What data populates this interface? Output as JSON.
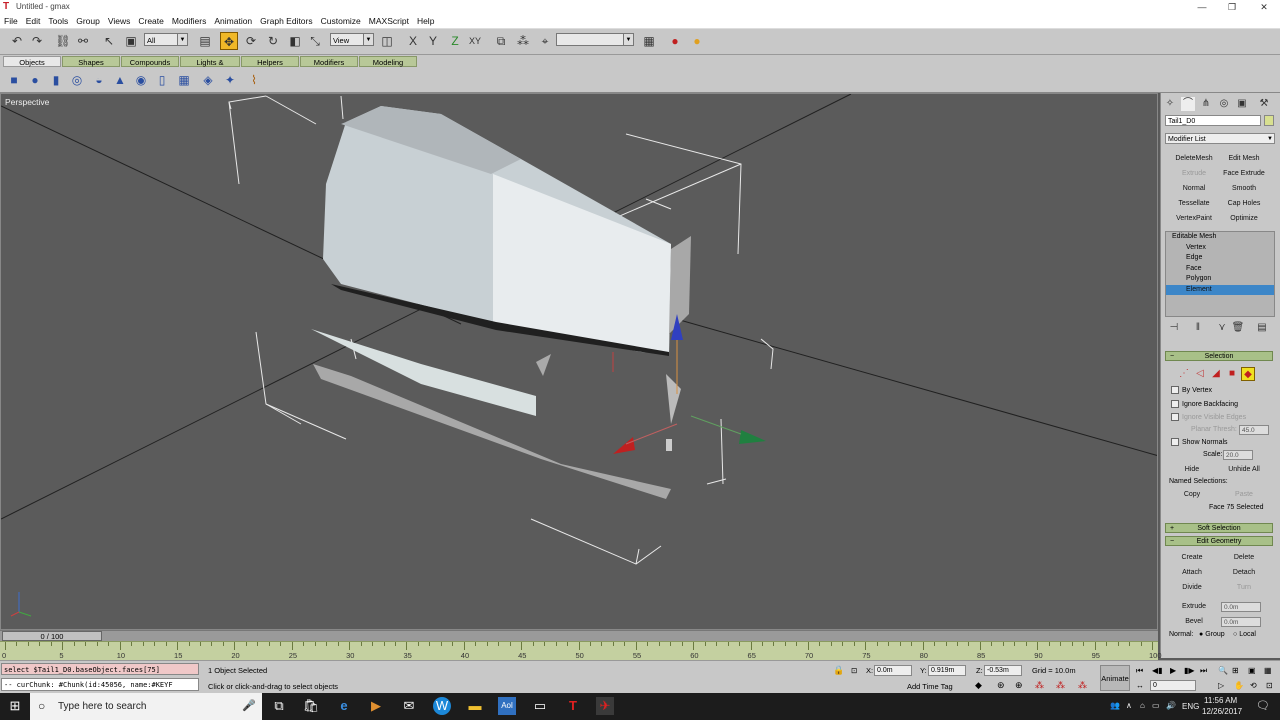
{
  "window": {
    "title": "Untitled - gmax",
    "minimize": "—",
    "maximize": "❐",
    "close": "✕"
  },
  "menu": [
    "File",
    "Edit",
    "Tools",
    "Group",
    "Views",
    "Create",
    "Modifiers",
    "Animation",
    "Graph Editors",
    "Customize",
    "MAXScript",
    "Help"
  ],
  "toolbar": {
    "selection_filter": "All",
    "ref_coord": "View",
    "named_selection": ""
  },
  "tabs": [
    "Objects",
    "Shapes",
    "Compounds",
    "Lights & Cameras",
    "Helpers",
    "Modifiers",
    "Modeling"
  ],
  "viewport": {
    "label": "Perspective"
  },
  "command_panel": {
    "object_name": "Tail1_D0",
    "modifier_list": "Modifier List",
    "modifier_buttons": [
      "DeleteMesh",
      "Edit Mesh",
      "Extrude",
      "Face Extrude",
      "Normal",
      "Smooth",
      "Tessellate",
      "Cap Holes",
      "VertexPaint",
      "Optimize"
    ],
    "stack": {
      "root": "Editable Mesh",
      "items": [
        "Vertex",
        "Edge",
        "Face",
        "Polygon",
        "Element"
      ],
      "selected": "Element"
    },
    "selection": {
      "title": "Selection",
      "by_vertex": "By Vertex",
      "ignore_backfacing": "Ignore Backfacing",
      "ignore_visible_edges": "Ignore Visible Edges",
      "planar_thresh_label": "Planar Thresh:",
      "planar_thresh_value": "45.0",
      "show_normals": "Show Normals",
      "scale_label": "Scale:",
      "scale_value": "20.0",
      "hide": "Hide",
      "unhide_all": "Unhide All",
      "named_selections": "Named Selections:",
      "copy": "Copy",
      "paste": "Paste",
      "status": "Face 75 Selected"
    },
    "soft_selection": "Soft Selection",
    "edit_geometry": {
      "title": "Edit Geometry",
      "create": "Create",
      "delete": "Delete",
      "attach": "Attach",
      "detach": "Detach",
      "divide": "Divide",
      "turn": "Turn",
      "extrude": "Extrude",
      "extrude_value": "0.0m",
      "bevel": "Bevel",
      "bevel_value": "0.0m",
      "normal": "Normal:",
      "group": "Group",
      "local": "Local"
    }
  },
  "timeline": {
    "frame": "0 / 100",
    "ticks": [
      "0",
      "5",
      "10",
      "15",
      "20",
      "25",
      "30",
      "35",
      "40",
      "45",
      "50",
      "55",
      "60",
      "65",
      "70",
      "75",
      "80",
      "85",
      "90",
      "95",
      "100"
    ]
  },
  "status": {
    "maxscript_line1": "select $Tail1_D0.baseObject.faces[75]",
    "maxscript_line2": "-- curChunk: #Chunk(id:45056, name:#KEYF",
    "selected": "1 Object Selected",
    "prompt": "Click or click-and-drag to select objects",
    "x_label": "X:",
    "x_value": "0.0m",
    "y_label": "Y:",
    "y_value": "0.919m",
    "z_label": "Z:",
    "z_value": "-0.53m",
    "grid": "Grid = 10.0m",
    "add_time_tag": "Add Time Tag",
    "animate": "Animate",
    "frame_field": "0"
  },
  "taskbar": {
    "search_placeholder": "Type here to search",
    "language": "ENG",
    "time": "11:56 AM",
    "date": "12/26/2017"
  },
  "colors": {
    "viewport_bg": "#5b5b5b",
    "panel_bg": "#c8c8c8",
    "tab_green": "#b8c898",
    "highlight": "#3c86c8"
  }
}
